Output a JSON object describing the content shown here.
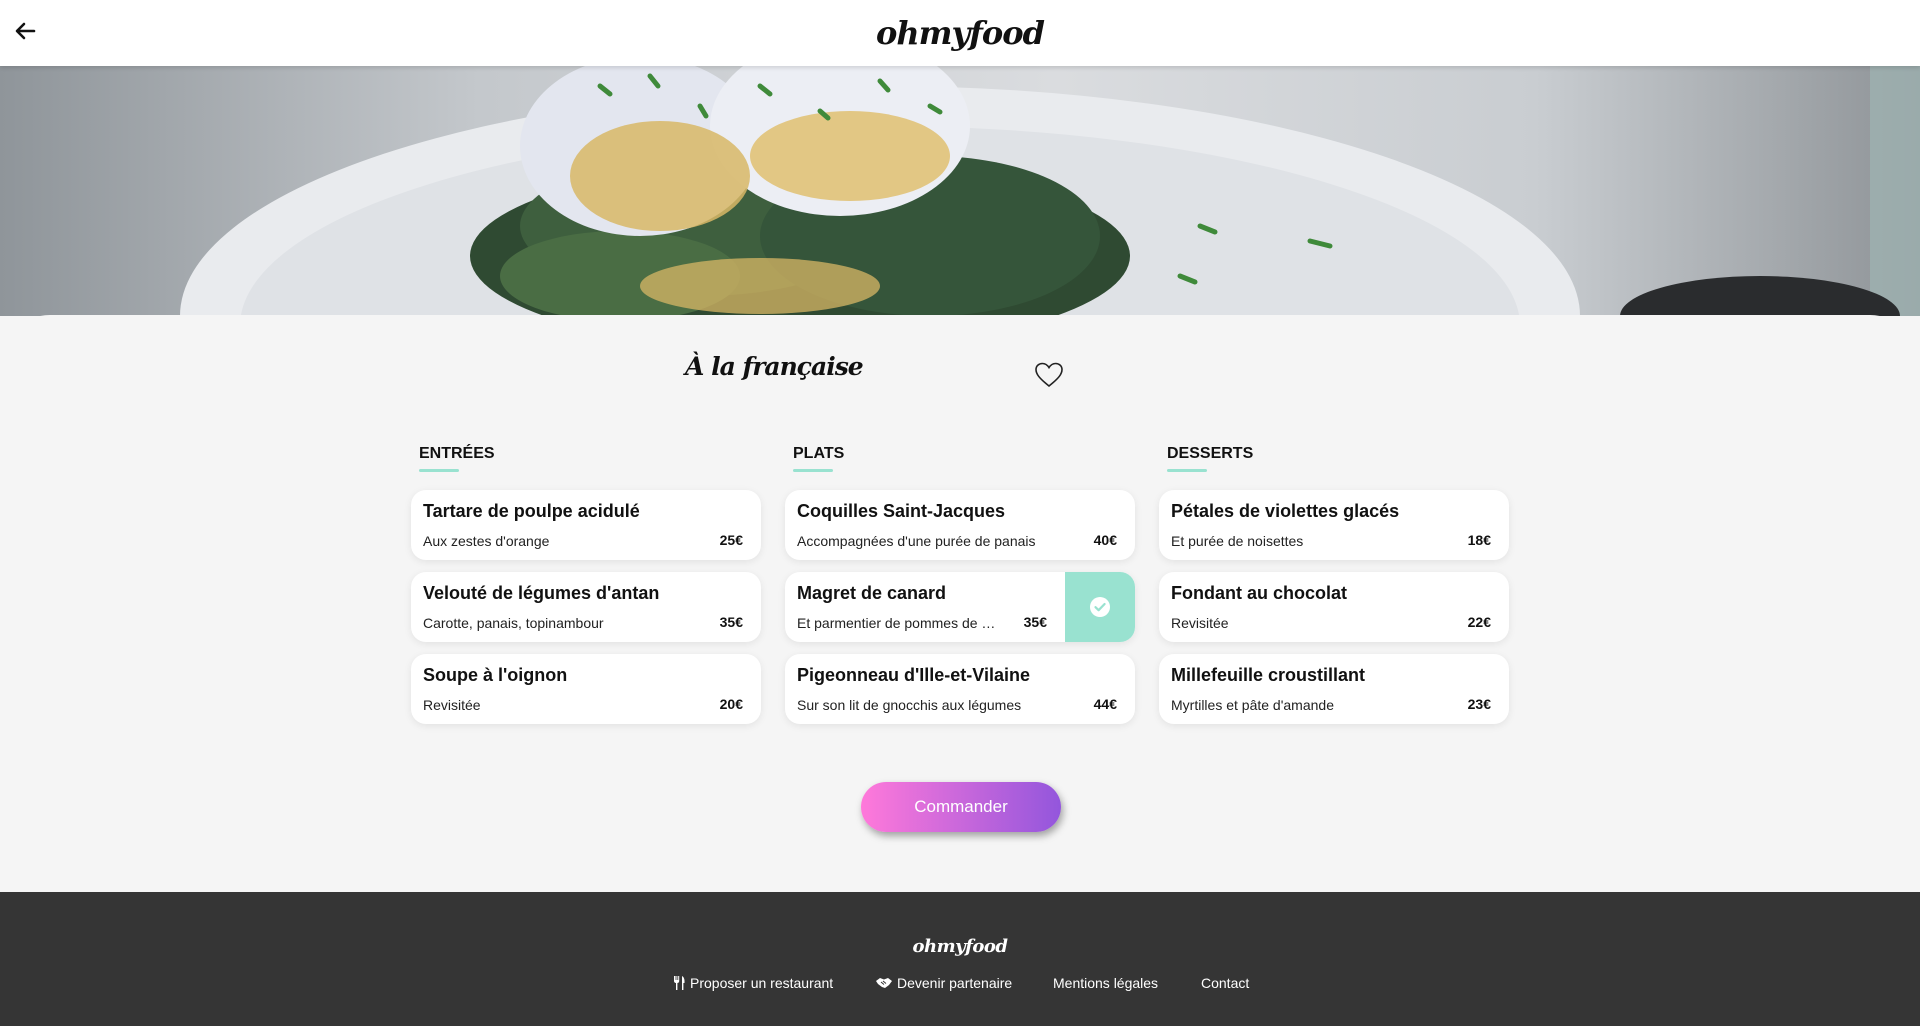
{
  "header": {
    "logo": "ohmyfood",
    "back_icon": "arrow-left-icon"
  },
  "restaurant": {
    "name": "À la française",
    "favorite_icon": "heart-outline-icon"
  },
  "menu": {
    "columns": [
      {
        "title": "ENTRÉES",
        "items": [
          {
            "name": "Tartare de poulpe acidulé",
            "description": "Aux zestes d'orange",
            "price": "25€"
          },
          {
            "name": "Velouté de légumes d'antan",
            "description": "Carotte, panais, topinambour",
            "price": "35€"
          },
          {
            "name": "Soupe à l'oignon",
            "description": "Revisitée",
            "price": "20€"
          }
        ]
      },
      {
        "title": "PLATS",
        "items": [
          {
            "name": "Coquilles Saint-Jacques",
            "description": "Accompagnées d'une purée de panais",
            "price": "40€"
          },
          {
            "name": "Magret de canard",
            "description": "Et parmentier de pommes de terre",
            "price": "35€",
            "selected": true
          },
          {
            "name": "Pigeonneau d'Ille-et-Vilaine",
            "description": "Sur son lit de gnocchis aux légumes",
            "price": "44€"
          }
        ]
      },
      {
        "title": "DESSERTS",
        "items": [
          {
            "name": "Pétales de violettes glacés",
            "description": "Et purée de noisettes",
            "price": "18€"
          },
          {
            "name": "Fondant au chocolat",
            "description": "Revisitée",
            "price": "22€"
          },
          {
            "name": "Millefeuille croustillant",
            "description": "Myrtilles et pâte d'amande",
            "price": "23€"
          }
        ]
      }
    ]
  },
  "order_button": "Commander",
  "footer": {
    "logo": "ohmyfood",
    "links": [
      {
        "label": "Proposer un restaurant",
        "icon": "utensils-icon"
      },
      {
        "label": "Devenir partenaire",
        "icon": "handshake-icon"
      },
      {
        "label": "Mentions légales"
      },
      {
        "label": "Contact"
      }
    ]
  },
  "colors": {
    "accent": "#99e2d0",
    "button_gradient_start": "#ff79da",
    "button_gradient_end": "#9356dc",
    "footer_bg": "#353535"
  }
}
